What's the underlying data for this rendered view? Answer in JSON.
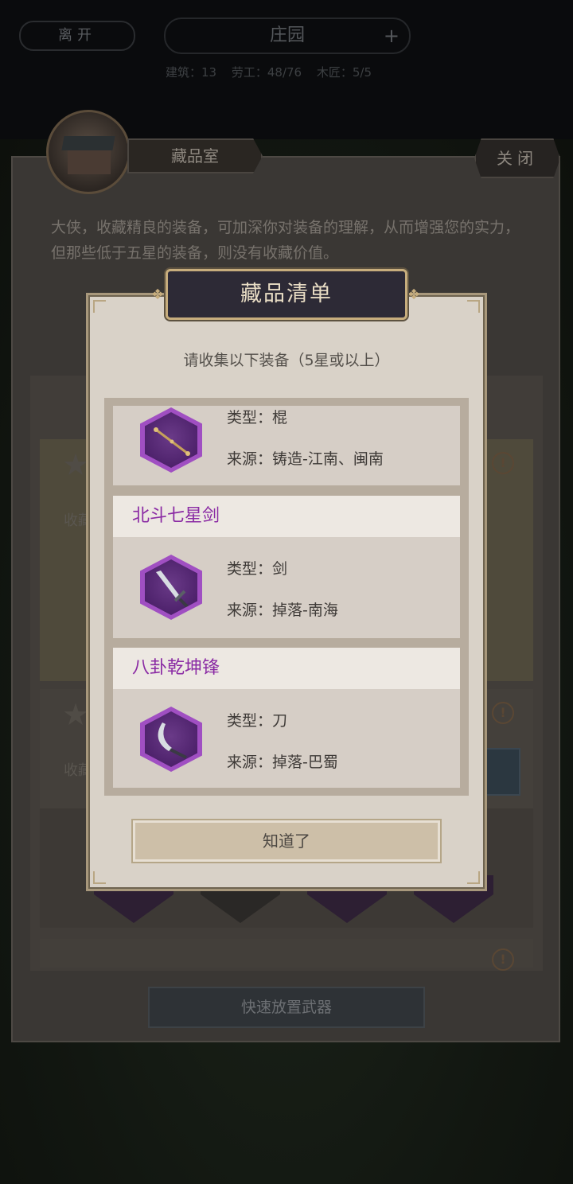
{
  "topbar": {
    "leave_label": "离开",
    "place_title": "庄园",
    "plus_symbol": "+",
    "stats": [
      "建筑：13",
      "劳工：48/76",
      "木匠：5/5"
    ]
  },
  "panel": {
    "room_tab_label": "藏品室",
    "close_label": "关闭",
    "description": "大侠，收藏精良的装备，可加深你对装备的理解，从而增强您的实力，但那些低于五星的装备，则没有收藏价值。",
    "bg_labels": [
      "收藏",
      "收藏"
    ],
    "warn_symbol": "!",
    "star_symbol": "★",
    "quick_place_label": "快速放置武器"
  },
  "dialog": {
    "title": "藏品清单",
    "subtitle": "请收集以下装备（5星或以上）",
    "items": [
      {
        "name": "",
        "type": "类型：棍",
        "source": "来源：铸造-江南、闽南",
        "icon": "staff-icon"
      },
      {
        "name": "北斗七星剑",
        "type": "类型：剑",
        "source": "来源：掉落-南海",
        "icon": "sword-icon"
      },
      {
        "name": "八卦乾坤锋",
        "type": "类型：刀",
        "source": "来源：掉落-巴蜀",
        "icon": "blade-icon"
      }
    ],
    "ok_label": "知道了"
  },
  "colors": {
    "item_name": "#8a2aa4",
    "hex_frame": "#a04fc2",
    "dialog_bg": "#d9d2c8"
  }
}
